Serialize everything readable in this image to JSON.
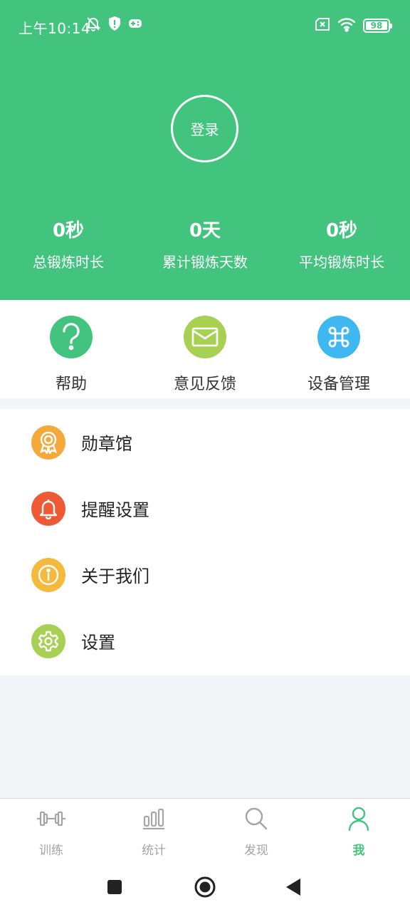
{
  "status_bar": {
    "time": "上午10:14",
    "battery": "98"
  },
  "header": {
    "login_label": "登录",
    "stats": [
      {
        "value": "0秒",
        "label": "总锻炼时长"
      },
      {
        "value": "0天",
        "label": "累计锻炼天数"
      },
      {
        "value": "0秒",
        "label": "平均锻炼时长"
      }
    ]
  },
  "quick_actions": [
    {
      "label": "帮助",
      "icon": "help-icon",
      "color": "#42c47f"
    },
    {
      "label": "意见反馈",
      "icon": "mail-icon",
      "color": "#a8d154"
    },
    {
      "label": "设备管理",
      "icon": "command-icon",
      "color": "#3fb7f0"
    }
  ],
  "menu": [
    {
      "label": "勋章馆",
      "icon": "medal-icon",
      "color": "#f4a93a"
    },
    {
      "label": "提醒设置",
      "icon": "bell-icon",
      "color": "#ef5a36"
    },
    {
      "label": "关于我们",
      "icon": "info-icon",
      "color": "#f4b93d"
    },
    {
      "label": "设置",
      "icon": "gear-icon",
      "color": "#a8d154"
    }
  ],
  "tabs": [
    {
      "label": "训练",
      "icon": "dumbbell-icon",
      "active": false
    },
    {
      "label": "统计",
      "icon": "bar-chart-icon",
      "active": false
    },
    {
      "label": "发现",
      "icon": "search-icon",
      "active": false
    },
    {
      "label": "我",
      "icon": "person-icon",
      "active": true
    }
  ],
  "colors": {
    "primary": "#42c47f",
    "inactive": "#a5a5a5"
  }
}
